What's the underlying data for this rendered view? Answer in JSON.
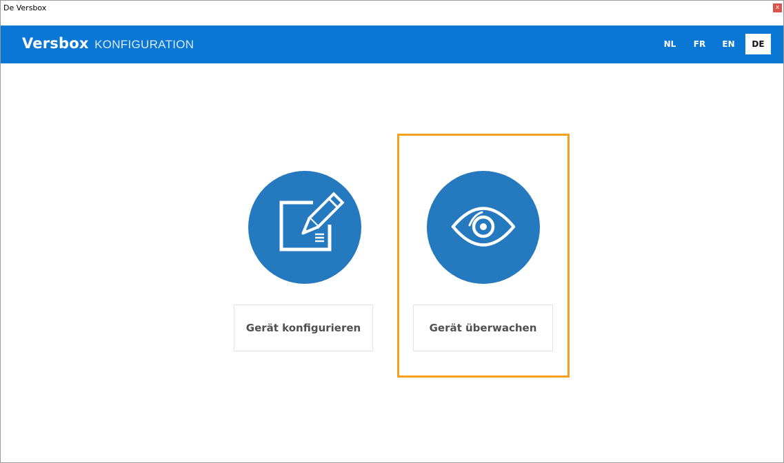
{
  "window": {
    "title": "De Versbox",
    "close_label": "x"
  },
  "header": {
    "brand_name": "Versbox",
    "brand_subtitle": "KONFIGURATION",
    "languages": [
      "NL",
      "FR",
      "EN",
      "DE"
    ],
    "active_language": "DE"
  },
  "actions": {
    "configure_label": "Gerät konfigurieren",
    "monitor_label": "Gerät überwachen"
  },
  "colors": {
    "header": "#0a77d5",
    "icon_circle": "#2579bf",
    "highlight": "#f5a11e",
    "close": "#d9534f"
  },
  "icons": {
    "configure": "edit-document-icon",
    "monitor": "eye-icon"
  }
}
